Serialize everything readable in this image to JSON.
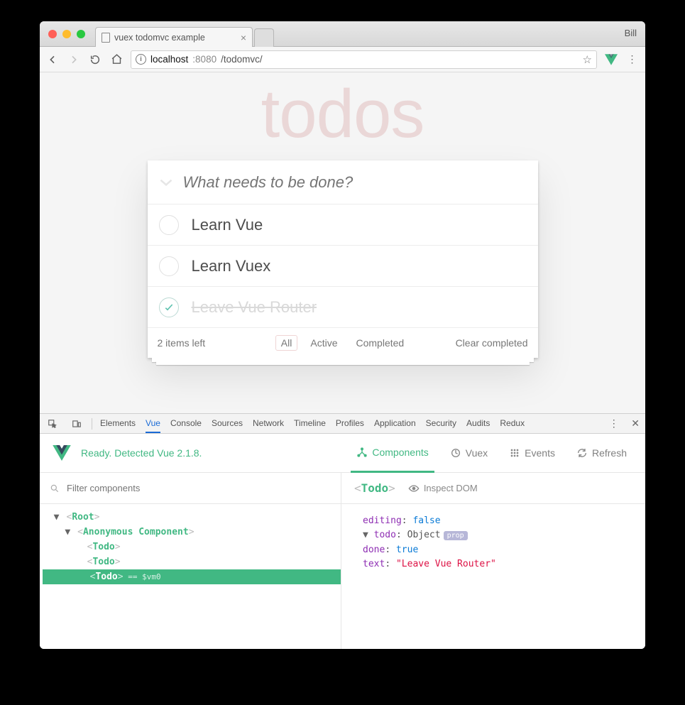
{
  "browser": {
    "tab_title": "vuex todomvc example",
    "profile": "Bill",
    "url_host": "localhost",
    "url_port": ":8080",
    "url_path": "/todomvc/"
  },
  "app": {
    "heading": "todos",
    "placeholder": "What needs to be done?",
    "items": [
      {
        "label": "Learn Vue",
        "done": false
      },
      {
        "label": "Learn Vuex",
        "done": false
      },
      {
        "label": "Leave Vue Router",
        "done": true
      }
    ],
    "count_label": "2 items left",
    "filters": {
      "all": "All",
      "active": "Active",
      "completed": "Completed"
    },
    "clear": "Clear completed"
  },
  "devtools": {
    "tabs": [
      "Elements",
      "Vue",
      "Console",
      "Sources",
      "Network",
      "Timeline",
      "Profiles",
      "Application",
      "Security",
      "Audits",
      "Redux"
    ],
    "active_tab": "Vue",
    "status": "Ready. Detected Vue 2.1.8.",
    "vue_tabs": {
      "components": "Components",
      "vuex": "Vuex",
      "events": "Events",
      "refresh": "Refresh"
    },
    "filter_placeholder": "Filter components",
    "tree": {
      "root": "Root",
      "anon": "Anonymous Component",
      "todo": "Todo",
      "sel_suffix": " == $vm0"
    },
    "inspect_label": "Inspect DOM",
    "selected_tag": "Todo",
    "props": {
      "editing_key": "editing",
      "editing_val": "false",
      "todo_key": "todo",
      "todo_type": "Object",
      "badge": "prop",
      "done_key": "done",
      "done_val": "true",
      "text_key": "text",
      "text_val": "\"Leave Vue Router\""
    }
  }
}
